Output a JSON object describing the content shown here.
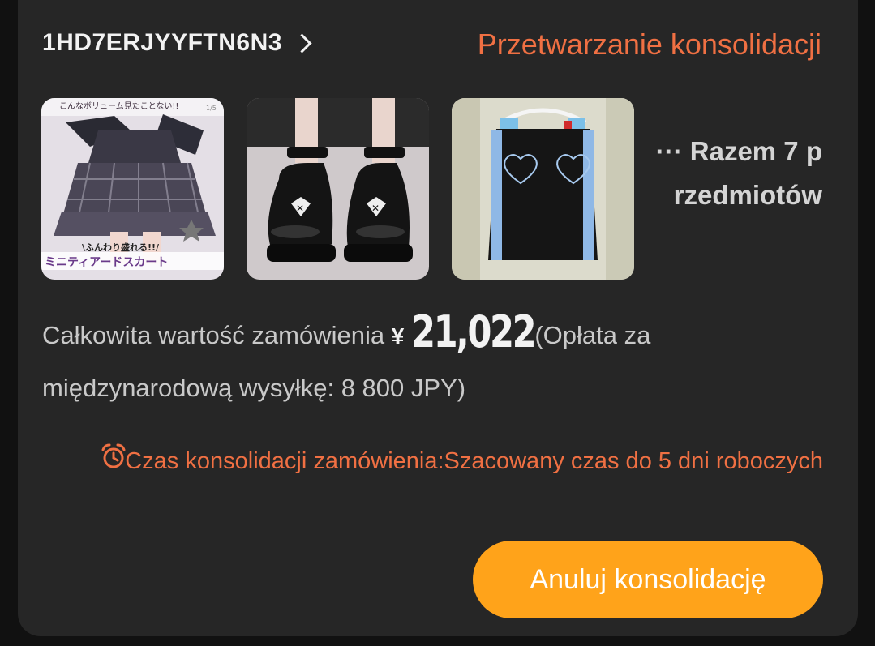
{
  "order": {
    "id": "1HD7ERJYYFTN6N3",
    "status": "Przetwarzanie konsolidacji"
  },
  "items": {
    "more_text": "··· Razem 7 przedmiotów",
    "thumbnails": [
      {
        "icon": "plaid-tiered-skirt-photo",
        "overlay_text_top": "こんなボリューム見たことない!!",
        "overlay_text_mid": "\\ふんわり盛れる!!/",
        "overlay_text_bottom": "ミニティアードスカート",
        "counter": "1/5"
      },
      {
        "icon": "black-platform-shoes-photo"
      },
      {
        "icon": "black-skirt-on-hanger-photo"
      }
    ]
  },
  "total": {
    "label": "Całkowita wartość zamówienia",
    "currency": "¥",
    "amount": "21,022",
    "shipping_note": "(Opłata za międzynarodową wysyłkę: 8 800 JPY)"
  },
  "notice": {
    "icon": "alarm-clock-icon",
    "text": "Czas konsolidacji zamówienia:Szacowany czas do 5 dni roboczych"
  },
  "actions": {
    "cancel_label": "Anuluj konsolidację"
  },
  "colors": {
    "accent_orange": "#f07043",
    "button_orange": "#ffa31a",
    "card_bg": "#262626"
  }
}
